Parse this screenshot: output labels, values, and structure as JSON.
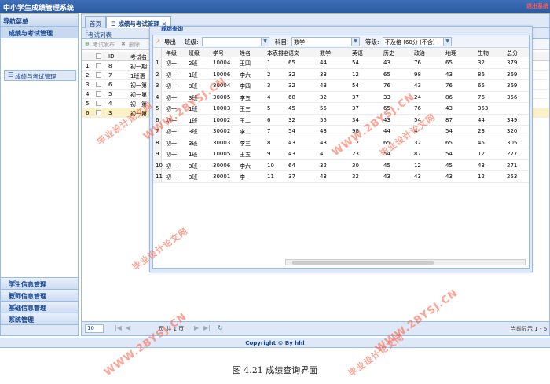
{
  "app": {
    "title": "中小学生成绩管理系统",
    "logout": "退出系统"
  },
  "sidebar": {
    "title": "导航菜单",
    "collapse_icon": "double-chevron-left-icon",
    "active_section": "成绩与考试管理",
    "active_item": "成绩与考试管理",
    "sections": [
      {
        "label": "学生信息管理"
      },
      {
        "label": "教师信息管理"
      },
      {
        "label": "基础信息管理"
      },
      {
        "label": "系统管理"
      }
    ]
  },
  "tabs": [
    {
      "label": "首页"
    },
    {
      "label": "成绩与考试管理"
    }
  ],
  "exam_panel": {
    "title": "考试列表",
    "publish_button": "考试发布",
    "delete_button": "删除",
    "columns": [
      "ID",
      "考试名"
    ],
    "rows": [
      {
        "n": "1",
        "id": "8",
        "name": "初一期"
      },
      {
        "n": "2",
        "id": "7",
        "name": "1班语"
      },
      {
        "n": "3",
        "id": "6",
        "name": "初一第"
      },
      {
        "n": "4",
        "id": "5",
        "name": "初一第"
      },
      {
        "n": "5",
        "id": "4",
        "name": "初一第"
      },
      {
        "n": "6",
        "id": "3",
        "name": "初一第"
      }
    ]
  },
  "pager": {
    "page_size": "10",
    "page_text": "页 共 1 页",
    "display": "当前显示 1 - 6"
  },
  "dialog": {
    "title": "成绩查询",
    "export_button": "导出",
    "grade_label": "班级:",
    "grade_value": "",
    "subject_label": "科目:",
    "subject_value": "数学",
    "level_label": "等级:",
    "level_value": "不及格 (60分 (不含)",
    "columns": [
      "年级",
      "班级",
      "学号",
      "姓名",
      "本表排名",
      "语文",
      "数学",
      "英语",
      "历史",
      "政治",
      "地理",
      "生物",
      "总分"
    ],
    "rows": [
      [
        "1",
        "初一",
        "2班",
        "10004",
        "王四",
        "1",
        "65",
        "44",
        "54",
        "43",
        "76",
        "65",
        "32",
        "379"
      ],
      [
        "2",
        "初一",
        "1班",
        "10006",
        "李六",
        "2",
        "32",
        "33",
        "12",
        "65",
        "98",
        "43",
        "86",
        "369"
      ],
      [
        "3",
        "初一",
        "3班",
        "30004",
        "李四",
        "3",
        "32",
        "43",
        "54",
        "76",
        "43",
        "76",
        "65",
        "369"
      ],
      [
        "4",
        "初一",
        "3班",
        "30005",
        "李五",
        "4",
        "68",
        "32",
        "37",
        "33",
        "24",
        "86",
        "76",
        "356"
      ],
      [
        "5",
        "初一",
        "1班",
        "10003",
        "王三",
        "5",
        "45",
        "55",
        "37",
        "65",
        "76",
        "43",
        "353"
      ],
      [
        "6",
        "初一",
        "1班",
        "10002",
        "王二",
        "6",
        "32",
        "55",
        "34",
        "43",
        "54",
        "87",
        "44",
        "349"
      ],
      [
        "7",
        "初一",
        "3班",
        "30002",
        "李二",
        "7",
        "54",
        "43",
        "98",
        "44",
        "4",
        "54",
        "23",
        "320"
      ],
      [
        "8",
        "初一",
        "3班",
        "30003",
        "李三",
        "8",
        "43",
        "43",
        "12",
        "65",
        "32",
        "65",
        "45",
        "305"
      ],
      [
        "9",
        "初一",
        "1班",
        "10005",
        "王五",
        "9",
        "43",
        "4",
        "23",
        "54",
        "87",
        "54",
        "12",
        "277"
      ],
      [
        "10",
        "初一",
        "3班",
        "30006",
        "李六",
        "10",
        "64",
        "32",
        "30",
        "45",
        "12",
        "45",
        "43",
        "271"
      ],
      [
        "11",
        "初一",
        "3班",
        "30001",
        "李一",
        "11",
        "37",
        "43",
        "32",
        "43",
        "43",
        "43",
        "12",
        "253"
      ]
    ]
  },
  "footer": "Copyright © By hhl",
  "caption": "图 4.21  成绩查询界面",
  "watermark": {
    "url": "WWW.2BYSJ.CN",
    "site": "毕业设计论文网"
  }
}
